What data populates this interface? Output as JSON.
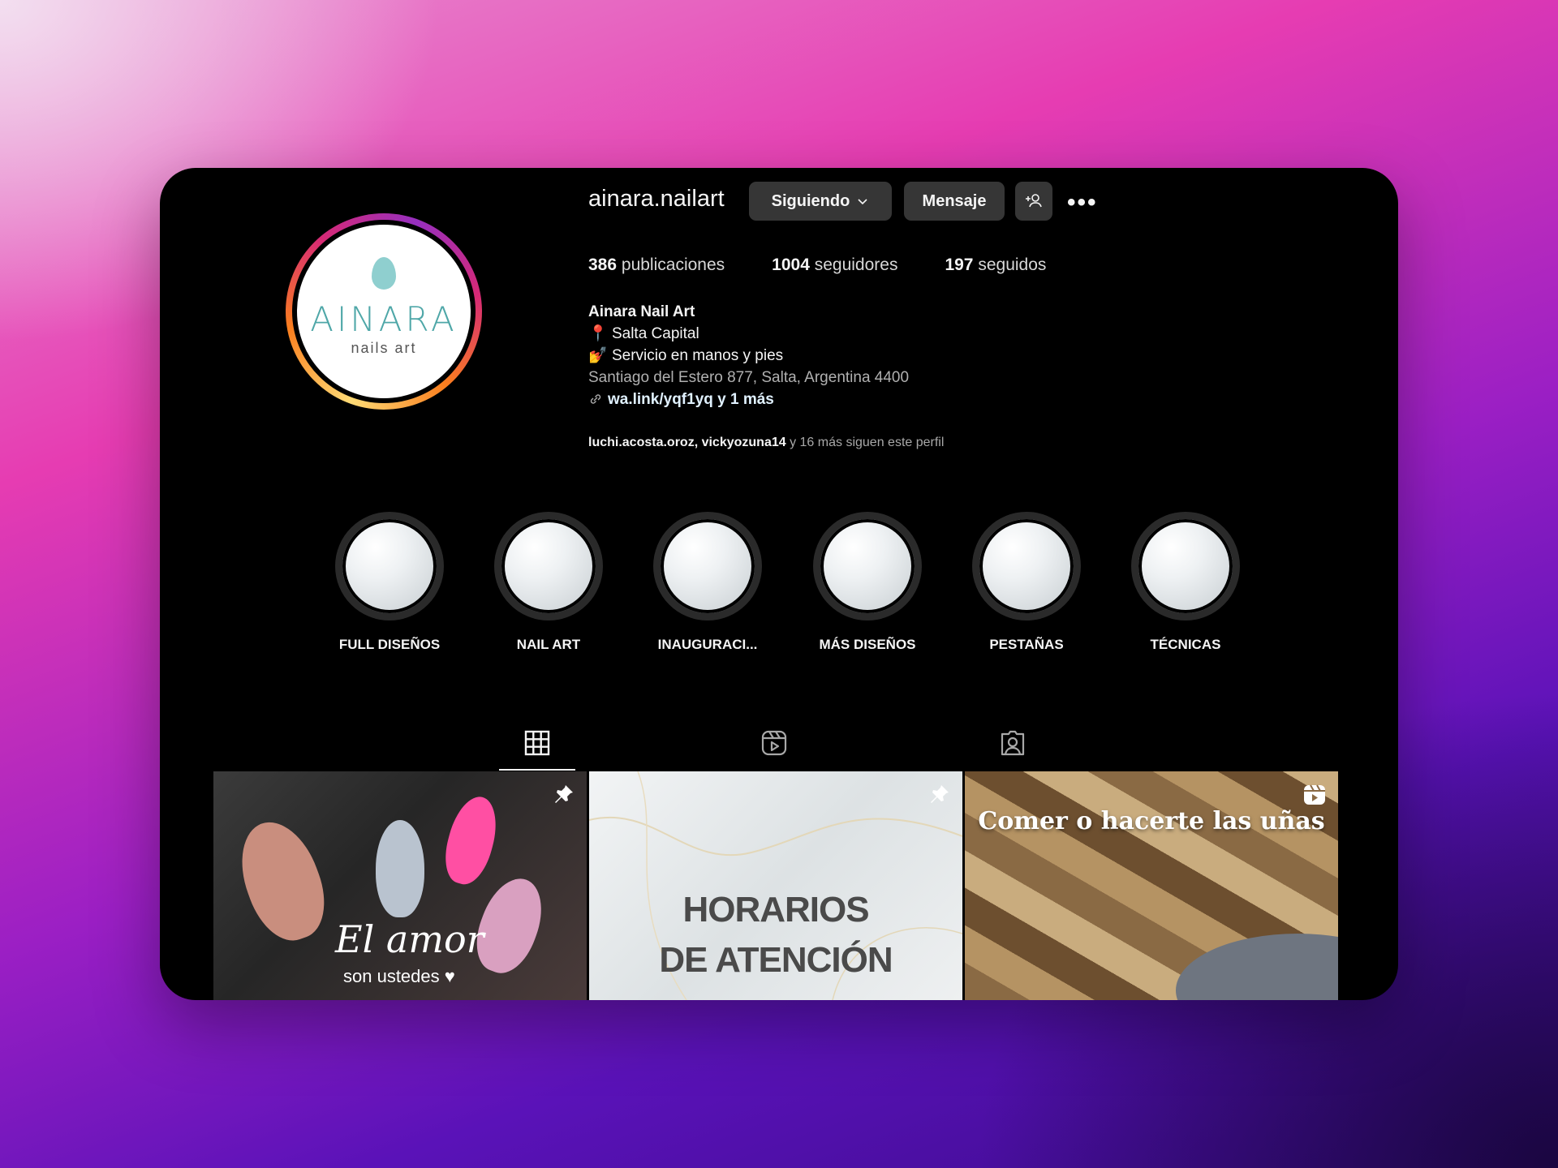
{
  "profile": {
    "username": "ainara.nailart",
    "follow_button": "Siguiendo",
    "message_button": "Mensaje",
    "more_glyph": "•••",
    "avatar": {
      "logo_word": "AINARA",
      "logo_sub": "nails art"
    }
  },
  "stats": [
    {
      "count": "386",
      "label": "publicaciones"
    },
    {
      "count": "1004",
      "label": "seguidores"
    },
    {
      "count": "197",
      "label": "seguidos"
    }
  ],
  "bio": {
    "name": "Ainara Nail Art",
    "location_emoji": "📍",
    "location": "Salta Capital",
    "service_emoji": "💅",
    "service": "Servicio en manos y pies",
    "address": "Santiago del Estero 877, Salta, Argentina 4400",
    "link": "wa.link/yqf1yq y 1 más"
  },
  "followed_by": {
    "names": "luchi.acosta.oroz, vickyozuna14",
    "rest": " y 16 más siguen este perfil"
  },
  "highlights": [
    {
      "label": "FULL DISEÑOS"
    },
    {
      "label": "NAIL ART"
    },
    {
      "label": "INAUGURACI..."
    },
    {
      "label": "MÁS DISEÑOS"
    },
    {
      "label": "PESTAÑAS"
    },
    {
      "label": "TÉCNICAS"
    }
  ],
  "tabs": [
    {
      "icon": "grid-icon",
      "active": true
    },
    {
      "icon": "reels-icon",
      "active": false
    },
    {
      "icon": "tagged-icon",
      "active": false
    }
  ],
  "posts": [
    {
      "text": "El amor",
      "subtext": "son ustedes ♥",
      "badge": "pin-icon"
    },
    {
      "text_line1": "HORARIOS",
      "text_line2": "DE ATENCIÓN",
      "badge": "pin-icon"
    },
    {
      "text": "Comer o hacerte las uñas",
      "badge": "reel-icon"
    }
  ],
  "colors": {
    "background": "#000000",
    "button": "#363636",
    "text": "#f5f5f5",
    "muted": "#a8a8a8",
    "logo_teal": "#4fa7a8"
  }
}
